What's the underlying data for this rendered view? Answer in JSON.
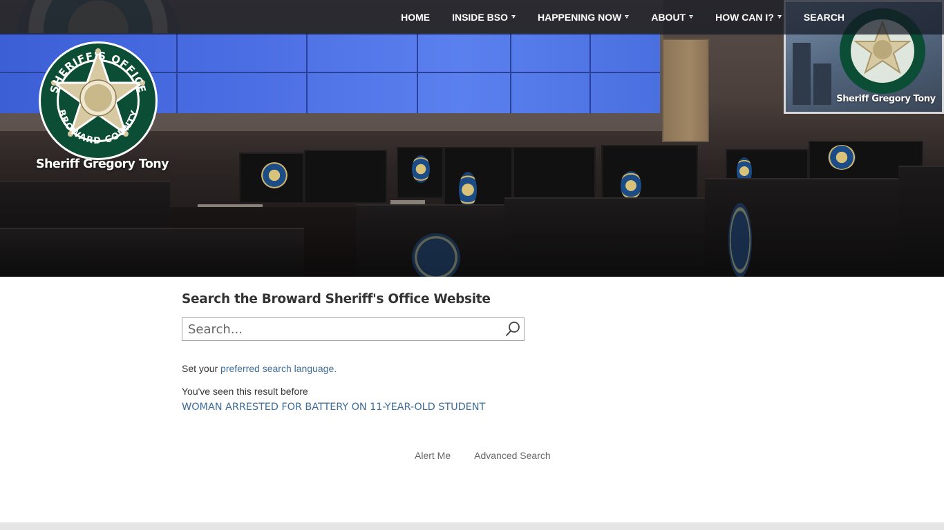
{
  "nav": {
    "items": [
      {
        "label": "HOME",
        "has_dropdown": false
      },
      {
        "label": "INSIDE BSO",
        "has_dropdown": true
      },
      {
        "label": "HAPPENING NOW",
        "has_dropdown": true
      },
      {
        "label": "ABOUT",
        "has_dropdown": true
      },
      {
        "label": "HOW CAN I?",
        "has_dropdown": true
      },
      {
        "label": "SEARCH",
        "has_dropdown": false
      }
    ]
  },
  "logo": {
    "badge_top_text": "SHERIFF'S OFFICE",
    "badge_bottom_text": "BROWARD COUNTY",
    "caption": "Sheriff Gregory Tony",
    "ring_color": "#0b4d35",
    "badge_color": "#d7c9a1"
  },
  "hero_screen": {
    "caption": "Sheriff Gregory Tony"
  },
  "search": {
    "title": "Search the Broward Sheriff's Office Website",
    "placeholder": "Search...",
    "value": "",
    "icon": "search-icon"
  },
  "language": {
    "prefix": "Set your",
    "link": "preferred search language."
  },
  "history": {
    "note": "You've seen this result before",
    "result_title": "WOMAN ARRESTED FOR BATTERY ON 11-YEAR-OLD STUDENT"
  },
  "actions": {
    "alert_me": "Alert Me",
    "advanced_search": "Advanced Search"
  },
  "colors": {
    "link": "#3f6e9a",
    "nav_text": "#ffffff",
    "title_text": "#333333",
    "footer": "#e5e5e5"
  }
}
